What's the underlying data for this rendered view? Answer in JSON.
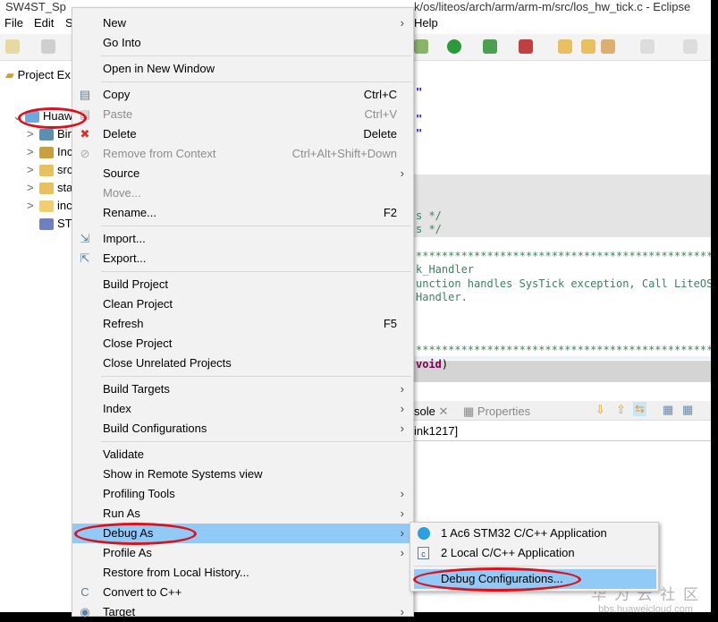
{
  "window": {
    "title_left": "SW4ST_Sp",
    "title_right": "k/os/liteos/arch/arm/arm-m/src/los_hw_tick.c - Eclipse"
  },
  "menubar": {
    "file": "File",
    "edit": "Edit",
    "s": "S",
    "help": "Help"
  },
  "explorer": {
    "title": "Project Ex",
    "items": [
      {
        "label": "Huaw",
        "chev": "v",
        "color": "#6fa8dc"
      },
      {
        "label": "Bin",
        "chev": ">",
        "color": "#5a8fb0"
      },
      {
        "label": "Inc",
        "chev": ">",
        "color": "#c9a040"
      },
      {
        "label": "src",
        "chev": ">",
        "color": "#e8c060"
      },
      {
        "label": "sta",
        "chev": ">",
        "color": "#e8c060"
      },
      {
        "label": "inc",
        "chev": ">",
        "color": "#f0cf70"
      },
      {
        "label": "ST",
        "chev": "",
        "color": "#6f7fbf"
      }
    ]
  },
  "editor": {
    "lines": [
      {
        "text": "\"",
        "cls": "str"
      },
      {
        "text": "\"",
        "cls": "str"
      },
      {
        "text": "\"",
        "cls": "str"
      },
      {
        "text": "s */",
        "cls": "cm"
      },
      {
        "text": "s */",
        "cls": "cm"
      },
      {
        "text": "**************************************************",
        "cls": "cm"
      },
      {
        "text": "k_Handler",
        "cls": "cm"
      },
      {
        "text": "unction handles SysTick exception, Call LiteOS i",
        "cls": "cm"
      },
      {
        "text": "Handler.",
        "cls": "cm"
      },
      {
        "text": "**************************************************",
        "cls": "cm"
      },
      {
        "text": "void",
        "cls": "kw",
        "suffix": ")"
      }
    ]
  },
  "console": {
    "tab_console": "sole",
    "tab_properties": "Properties",
    "line": "ink1217]"
  },
  "context_menu": {
    "items": [
      {
        "label": "New",
        "arrow": true
      },
      {
        "label": "Go Into"
      },
      {
        "sep": true
      },
      {
        "label": "Open in New Window"
      },
      {
        "sep": true
      },
      {
        "label": "Copy",
        "shortcut": "Ctrl+C",
        "icon": "copy-icon",
        "glyph": "▤"
      },
      {
        "label": "Paste",
        "shortcut": "Ctrl+V",
        "disabled": true,
        "icon": "paste-icon",
        "glyph": "▤"
      },
      {
        "label": "Delete",
        "shortcut": "Delete",
        "icon": "delete-icon",
        "glyph": "✖"
      },
      {
        "label": "Remove from Context",
        "shortcut": "Ctrl+Alt+Shift+Down",
        "disabled": true,
        "icon": "remove-context-icon",
        "glyph": "⊘"
      },
      {
        "label": "Source",
        "arrow": true
      },
      {
        "label": "Move...",
        "disabled": true
      },
      {
        "label": "Rename...",
        "shortcut": "F2"
      },
      {
        "sep": true
      },
      {
        "label": "Import...",
        "icon": "import-icon",
        "glyph": "⇲"
      },
      {
        "label": "Export...",
        "icon": "export-icon",
        "glyph": "⇱"
      },
      {
        "sep": true
      },
      {
        "label": "Build Project"
      },
      {
        "label": "Clean Project"
      },
      {
        "label": "Refresh",
        "shortcut": "F5"
      },
      {
        "label": "Close Project"
      },
      {
        "label": "Close Unrelated Projects"
      },
      {
        "sep": true
      },
      {
        "label": "Build Targets",
        "arrow": true
      },
      {
        "label": "Index",
        "arrow": true
      },
      {
        "label": "Build Configurations",
        "arrow": true
      },
      {
        "sep": true
      },
      {
        "label": "Validate"
      },
      {
        "label": "Show in Remote Systems view"
      },
      {
        "label": "Profiling Tools",
        "arrow": true
      },
      {
        "label": "Run As",
        "arrow": true
      },
      {
        "label": "Debug As",
        "arrow": true,
        "highlighted": true
      },
      {
        "label": "Profile As",
        "arrow": true
      },
      {
        "label": "Restore from Local History..."
      },
      {
        "label": "Convert to C++",
        "icon": "convert-cpp-icon",
        "glyph": "C"
      },
      {
        "label": "Target",
        "arrow": true,
        "icon": "target-icon",
        "glyph": "◉"
      }
    ]
  },
  "submenu": {
    "items": [
      {
        "label": "1 Ac6 STM32 C/C++ Application",
        "icon": "ac6-app-icon"
      },
      {
        "label": "2 Local C/C++ Application",
        "icon": "local-app-icon"
      },
      {
        "label": "Debug Configurations...",
        "highlighted": true
      }
    ]
  },
  "watermark": {
    "cn": "华 为 云 社 区",
    "url": "bbs.huaweicloud.com"
  },
  "colors": {
    "highlight": "#91c9f7",
    "annotation": "#e0101a"
  }
}
